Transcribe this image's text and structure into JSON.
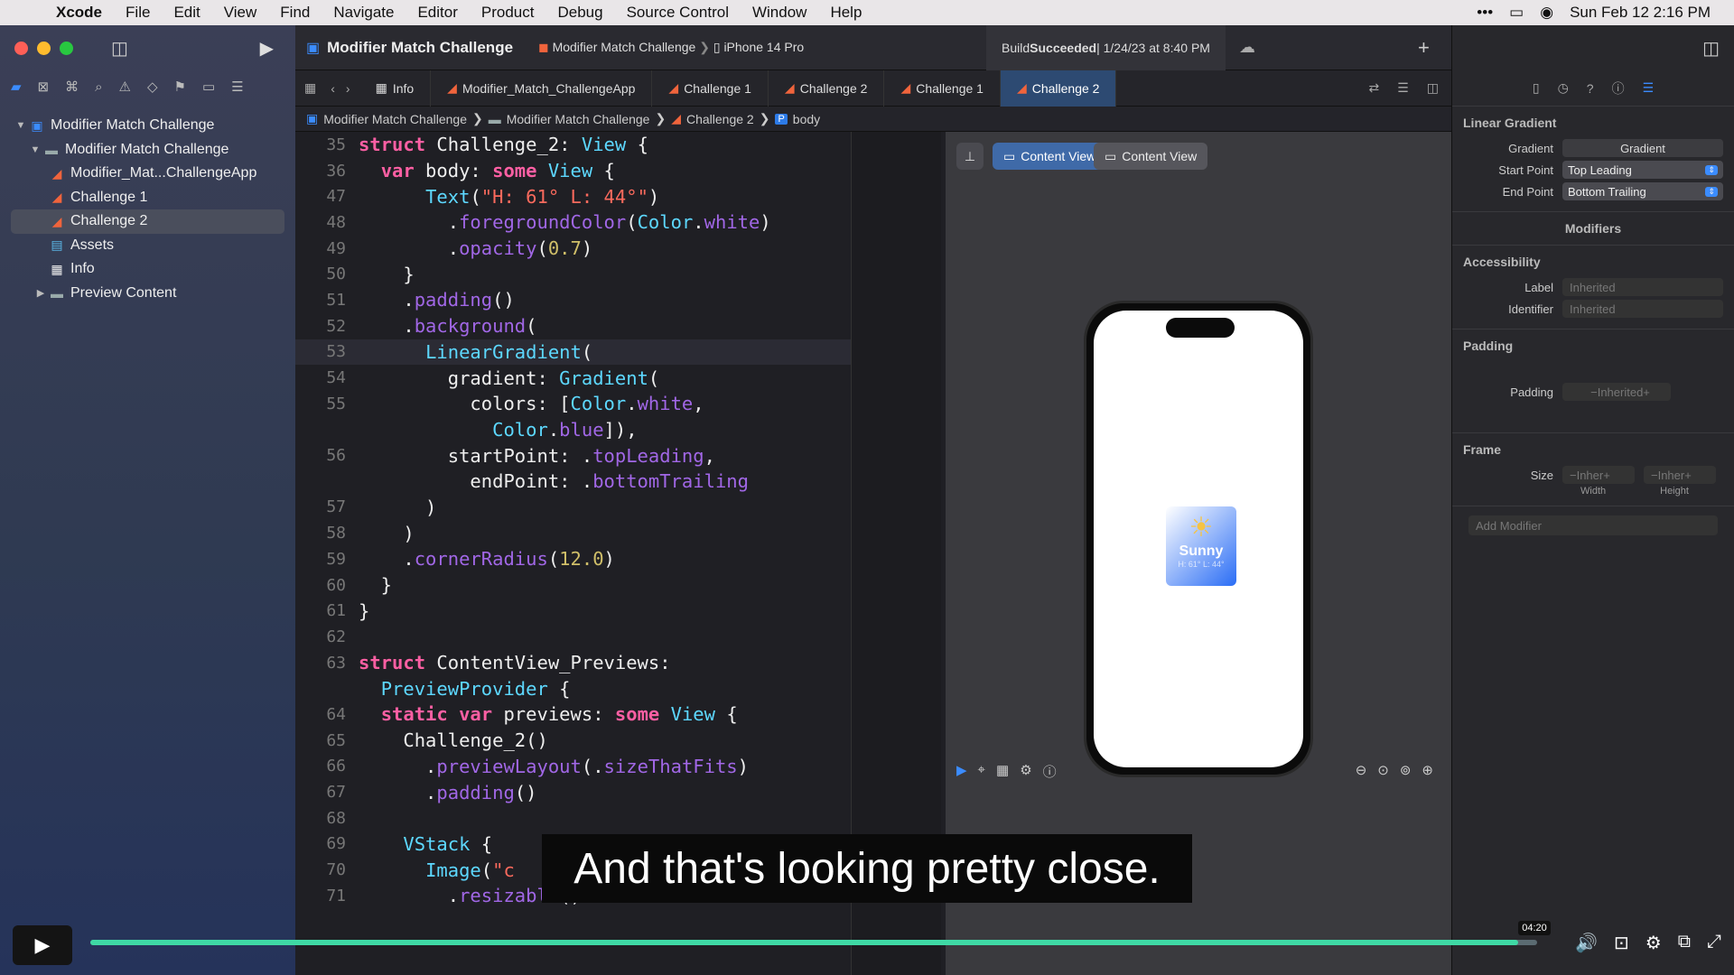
{
  "menubar": {
    "app": "Xcode",
    "items": [
      "File",
      "Edit",
      "View",
      "Find",
      "Navigate",
      "Editor",
      "Product",
      "Debug",
      "Source Control",
      "Window",
      "Help"
    ],
    "datetime": "Sun Feb 12  2:16 PM"
  },
  "toolbar": {
    "project_title": "Modifier Match Challenge",
    "scheme": "Modifier Match Challenge",
    "device": "iPhone 14 Pro",
    "build_prefix": "Build ",
    "build_status": "Succeeded",
    "build_time": " | 1/24/23 at 8:40 PM"
  },
  "tabs": [
    {
      "label": "Info",
      "icon": "table-icon"
    },
    {
      "label": "Modifier_Match_ChallengeApp",
      "icon": "swift-icon"
    },
    {
      "label": "Challenge 1",
      "icon": "swift-icon"
    },
    {
      "label": "Challenge 2",
      "icon": "swift-icon"
    },
    {
      "label": "Challenge 1",
      "icon": "swift-icon"
    },
    {
      "label": "Challenge 2",
      "icon": "swift-icon",
      "active": true
    }
  ],
  "breadcrumbs": [
    "Modifier Match Challenge",
    "Modifier Match Challenge",
    "Challenge 2",
    "body"
  ],
  "navigator": {
    "items": [
      {
        "label": "Modifier Match Challenge",
        "level": 0
      },
      {
        "label": "Modifier Match Challenge",
        "level": 1
      },
      {
        "label": "Modifier_Mat...ChallengeApp",
        "level": 2
      },
      {
        "label": "Challenge 1",
        "level": 2
      },
      {
        "label": "Challenge 2",
        "level": 2,
        "selected": true
      },
      {
        "label": "Assets",
        "level": 2
      },
      {
        "label": "Info",
        "level": 2
      },
      {
        "label": "Preview Content",
        "level": 2
      }
    ]
  },
  "code": {
    "current_line": 53,
    "lines": [
      {
        "n": "35",
        "t": "struct Challenge_2: View {"
      },
      {
        "n": "36",
        "t": "  var body: some View {"
      },
      {
        "n": "47",
        "t": "      Text(\"H: 61° L: 44°\")"
      },
      {
        "n": "48",
        "t": "        .foregroundColor(Color.white)"
      },
      {
        "n": "49",
        "t": "        .opacity(0.7)"
      },
      {
        "n": "50",
        "t": "    }"
      },
      {
        "n": "51",
        "t": "    .padding()"
      },
      {
        "n": "52",
        "t": "    .background("
      },
      {
        "n": "53",
        "t": "      LinearGradient("
      },
      {
        "n": "54",
        "t": "        gradient: Gradient("
      },
      {
        "n": "55",
        "t": "          colors: [Color.white,"
      },
      {
        "n": "",
        "t": "            Color.blue]),"
      },
      {
        "n": "56",
        "t": "        startPoint: .topLeading,"
      },
      {
        "n": "",
        "t": "          endPoint: .bottomTrailing"
      },
      {
        "n": "57",
        "t": "      )"
      },
      {
        "n": "58",
        "t": "    )"
      },
      {
        "n": "59",
        "t": "    .cornerRadius(12.0)"
      },
      {
        "n": "60",
        "t": "  }"
      },
      {
        "n": "61",
        "t": "}"
      },
      {
        "n": "62",
        "t": ""
      },
      {
        "n": "63",
        "t": "struct ContentView_Previews:"
      },
      {
        "n": "",
        "t": "  PreviewProvider {"
      },
      {
        "n": "64",
        "t": "  static var previews: some View {"
      },
      {
        "n": "65",
        "t": "    Challenge_2()"
      },
      {
        "n": "66",
        "t": "      .previewLayout(.sizeThatFits)"
      },
      {
        "n": "67",
        "t": "      .padding()"
      },
      {
        "n": "68",
        "t": ""
      },
      {
        "n": "69",
        "t": "    VStack {"
      },
      {
        "n": "70",
        "t": "      Image(\"c"
      },
      {
        "n": "71",
        "t": "        .resizable()"
      }
    ]
  },
  "preview": {
    "btn1": "Content View",
    "btn2": "Content View",
    "card_title": "Sunny",
    "card_sub": "H: 61° L: 44°"
  },
  "inspector": {
    "section_title": "Linear Gradient",
    "gradient_label": "Gradient",
    "gradient_value": "Gradient",
    "start_label": "Start Point",
    "start_value": "Top Leading",
    "end_label": "End Point",
    "end_value": "Bottom Trailing",
    "modifiers": "Modifiers",
    "accessibility": "Accessibility",
    "label_label": "Label",
    "label_value": "Inherited",
    "identifier_label": "Identifier",
    "identifier_value": "Inherited",
    "padding_title": "Padding",
    "padding_label": "Padding",
    "padding_value": "Inherited",
    "frame_title": "Frame",
    "size_label": "Size",
    "width_value": "Inher",
    "height_value": "Inher",
    "width_label": "Width",
    "height_label": "Height",
    "add_modifier": "Add Modifier"
  },
  "video": {
    "caption": "And that's looking pretty close.",
    "time": "04:20",
    "progress_fraction": 0.987
  }
}
